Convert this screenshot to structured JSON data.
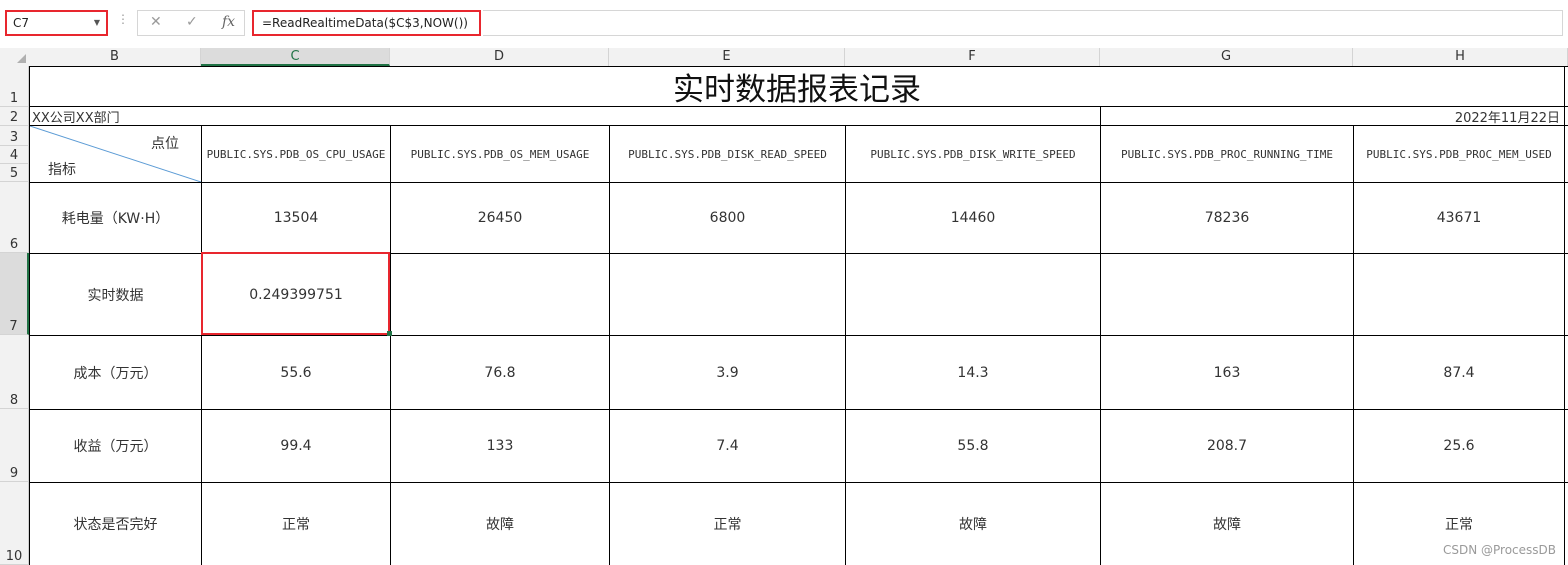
{
  "formula_bar": {
    "name_box": "C7",
    "cancel_icon": "✕",
    "enter_icon": "✓",
    "fx_label": "fx",
    "formula": "=ReadRealtimeData($C$3,NOW())"
  },
  "columns": [
    "B",
    "C",
    "D",
    "E",
    "F",
    "G",
    "H"
  ],
  "rows": [
    "1",
    "2",
    "3",
    "4",
    "5",
    "6",
    "7",
    "8",
    "9",
    "10"
  ],
  "report": {
    "title": "实时数据报表记录",
    "company": "XX公司XX部门",
    "date": "2022年11月22日",
    "diag_top": "点位",
    "diag_bottom": "指标",
    "tags": [
      "PUBLIC.SYS.PDB_OS_CPU_USAGE",
      "PUBLIC.SYS.PDB_OS_MEM_USAGE",
      "PUBLIC.SYS.PDB_DISK_READ_SPEED",
      "PUBLIC.SYS.PDB_DISK_WRITE_SPEED",
      "PUBLIC.SYS.PDB_PROC_RUNNING_TIME",
      "PUBLIC.SYS.PDB_PROC_MEM_USED"
    ],
    "metrics": [
      {
        "label": "耗电量（KW·H）",
        "values": [
          "13504",
          "26450",
          "6800",
          "14460",
          "78236",
          "43671"
        ]
      },
      {
        "label": "实时数据",
        "values": [
          "0.249399751",
          "",
          "",
          "",
          "",
          ""
        ]
      },
      {
        "label": "成本（万元）",
        "values": [
          "55.6",
          "76.8",
          "3.9",
          "14.3",
          "163",
          "87.4"
        ]
      },
      {
        "label": "收益（万元）",
        "values": [
          "99.4",
          "133",
          "7.4",
          "55.8",
          "208.7",
          "25.6"
        ]
      },
      {
        "label": "状态是否完好",
        "values": [
          "正常",
          "故障",
          "正常",
          "故障",
          "故障",
          "正常"
        ]
      }
    ]
  },
  "watermark": "CSDN @ProcessDB"
}
